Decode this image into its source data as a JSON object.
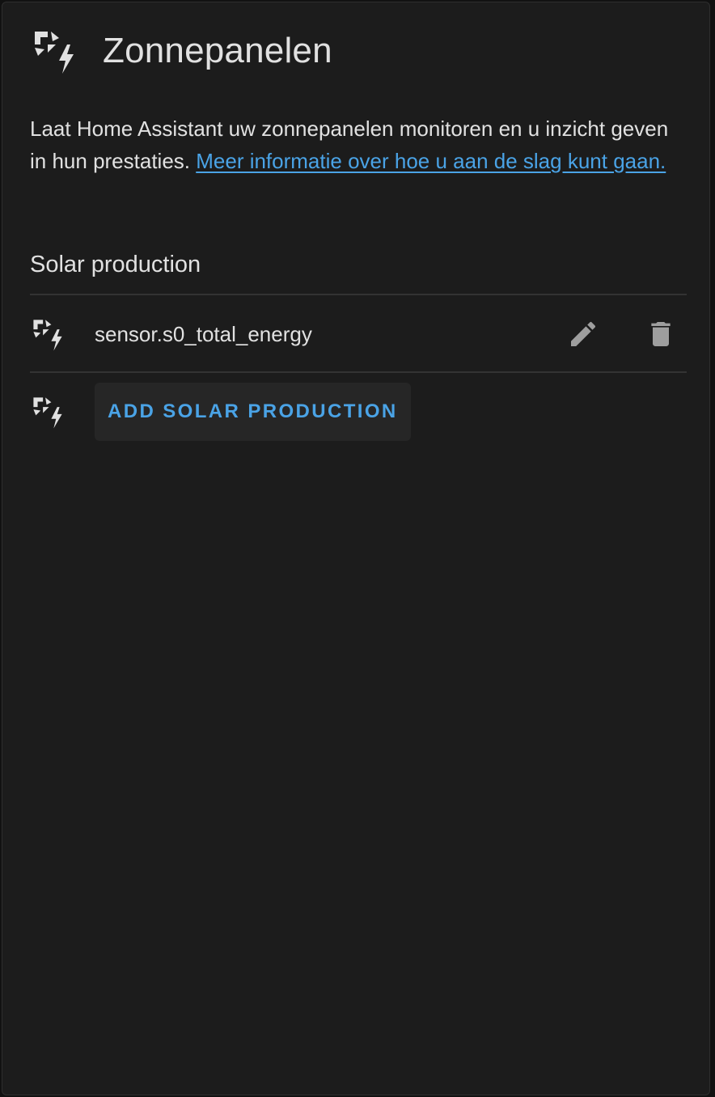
{
  "card": {
    "icon": "solar-power-icon",
    "title": "Zonnepanelen",
    "description_text": "Laat Home Assistant uw zonnepanelen monitoren en u inzicht geven in hun prestaties. ",
    "description_link": "Meer informatie over hoe u aan de slag kunt gaan."
  },
  "section": {
    "title": "Solar production",
    "sources": [
      {
        "icon": "solar-power-icon",
        "entity": "sensor.s0_total_energy"
      }
    ],
    "add_button_label": "ADD SOLAR PRODUCTION"
  },
  "actions": {
    "edit_icon": "pencil-icon",
    "delete_icon": "trash-icon"
  },
  "colors": {
    "background": "#1c1c1c",
    "text": "#e1e1e1",
    "accent": "#4aa3e6",
    "icon": "#9e9e9e",
    "divider": "#333333"
  }
}
